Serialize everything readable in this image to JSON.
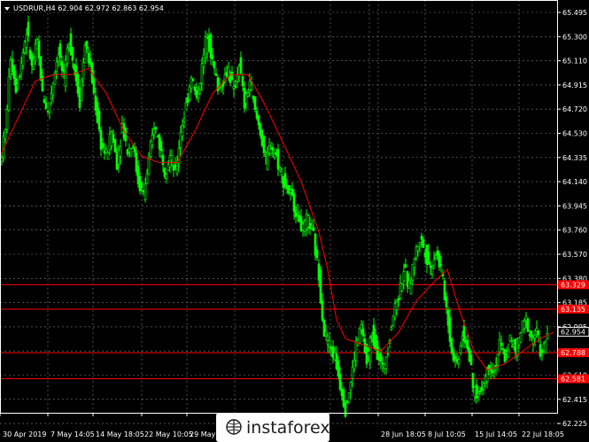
{
  "window": {
    "symbol_info": "USDRUR,H4  62.904 62.972 62.863 62.954",
    "watermark": "instaforex"
  },
  "colors": {
    "background": "#000000",
    "grid": "#808080",
    "bull_candle": "#00ff00",
    "bear_candle": "#00ff00",
    "moving_average": "#ff0000",
    "level_line": "#ff0000",
    "current_price_tag": "#ffffff"
  },
  "chart_data": {
    "type": "candlestick",
    "title": "USDRUR,H4",
    "ohlc_header": {
      "open": 62.904,
      "high": 62.972,
      "low": 62.863,
      "close": 62.954
    },
    "y_ticks": [
      "65.495",
      "65.300",
      "65.110",
      "64.915",
      "64.720",
      "64.530",
      "64.335",
      "64.140",
      "63.945",
      "63.760",
      "63.570",
      "63.380",
      "63.185",
      "62.995",
      "62.800",
      "62.610",
      "62.415",
      "62.225"
    ],
    "x_ticks": [
      "30 Apr 2019",
      "7 May 14:05",
      "14 May 18:05",
      "22 May 10:05",
      "29 May",
      "",
      "",
      "",
      "",
      "28 Jun 18:05",
      "8 Jul 10:05",
      "15 Jul 14:05",
      "22 Jul 18:05"
    ],
    "ylim": [
      62.19,
      65.55
    ],
    "levels": [
      {
        "label": "63.329",
        "value": 63.329
      },
      {
        "label": "63.135",
        "value": 63.135
      },
      {
        "label": "62.788",
        "value": 62.788
      },
      {
        "label": "62.581",
        "value": 62.581
      }
    ],
    "current_price": {
      "label": "62.954",
      "value": 62.954
    },
    "price_path": [
      [
        0,
        64.3
      ],
      [
        6,
        64.55
      ],
      [
        12,
        65.15
      ],
      [
        18,
        64.9
      ],
      [
        24,
        65.1
      ],
      [
        30,
        65.35
      ],
      [
        36,
        65.05
      ],
      [
        42,
        65.25
      ],
      [
        48,
        64.85
      ],
      [
        54,
        64.7
      ],
      [
        60,
        64.95
      ],
      [
        66,
        65.2
      ],
      [
        72,
        64.95
      ],
      [
        78,
        65.3
      ],
      [
        84,
        65.05
      ],
      [
        90,
        64.8
      ],
      [
        96,
        65.25
      ],
      [
        102,
        65.05
      ],
      [
        108,
        64.75
      ],
      [
        114,
        64.45
      ],
      [
        120,
        64.35
      ],
      [
        126,
        64.55
      ],
      [
        132,
        64.3
      ],
      [
        138,
        64.6
      ],
      [
        144,
        64.4
      ],
      [
        150,
        64.45
      ],
      [
        156,
        64.15
      ],
      [
        162,
        64.05
      ],
      [
        168,
        64.3
      ],
      [
        174,
        64.6
      ],
      [
        180,
        64.45
      ],
      [
        186,
        64.25
      ],
      [
        192,
        64.35
      ],
      [
        198,
        64.2
      ],
      [
        204,
        64.55
      ],
      [
        210,
        64.75
      ],
      [
        216,
        65.0
      ],
      [
        222,
        64.8
      ],
      [
        228,
        65.05
      ],
      [
        234,
        65.35
      ],
      [
        240,
        65.1
      ],
      [
        246,
        64.9
      ],
      [
        252,
        64.95
      ],
      [
        258,
        65.05
      ],
      [
        264,
        64.85
      ],
      [
        270,
        65.1
      ],
      [
        276,
        64.75
      ],
      [
        282,
        64.95
      ],
      [
        288,
        64.7
      ],
      [
        294,
        64.55
      ],
      [
        300,
        64.3
      ],
      [
        306,
        64.45
      ],
      [
        312,
        64.35
      ],
      [
        318,
        64.2
      ],
      [
        324,
        64.1
      ],
      [
        330,
        64.0
      ],
      [
        336,
        63.9
      ],
      [
        342,
        63.75
      ],
      [
        348,
        63.85
      ],
      [
        354,
        63.7
      ],
      [
        360,
        63.4
      ],
      [
        366,
        62.95
      ],
      [
        372,
        62.85
      ],
      [
        378,
        62.75
      ],
      [
        384,
        62.55
      ],
      [
        390,
        62.35
      ],
      [
        396,
        62.55
      ],
      [
        402,
        62.85
      ],
      [
        408,
        63.0
      ],
      [
        414,
        62.7
      ],
      [
        420,
        62.95
      ],
      [
        426,
        62.8
      ],
      [
        432,
        62.65
      ],
      [
        438,
        62.85
      ],
      [
        444,
        63.1
      ],
      [
        450,
        63.25
      ],
      [
        456,
        63.45
      ],
      [
        462,
        63.3
      ],
      [
        468,
        63.55
      ],
      [
        474,
        63.7
      ],
      [
        480,
        63.6
      ],
      [
        486,
        63.45
      ],
      [
        492,
        63.6
      ],
      [
        498,
        63.45
      ],
      [
        504,
        63.15
      ],
      [
        510,
        62.8
      ],
      [
        516,
        62.7
      ],
      [
        522,
        62.95
      ],
      [
        528,
        62.85
      ],
      [
        534,
        62.5
      ],
      [
        540,
        62.45
      ],
      [
        546,
        62.55
      ],
      [
        552,
        62.7
      ],
      [
        558,
        62.65
      ],
      [
        564,
        62.85
      ],
      [
        570,
        62.75
      ],
      [
        576,
        62.9
      ],
      [
        582,
        62.8
      ],
      [
        588,
        62.95
      ],
      [
        594,
        63.05
      ],
      [
        600,
        62.9
      ],
      [
        606,
        62.95
      ],
      [
        612,
        62.75
      ],
      [
        618,
        62.95
      ]
    ],
    "ma_path": [
      [
        0,
        64.35
      ],
      [
        20,
        64.65
      ],
      [
        40,
        64.95
      ],
      [
        60,
        65.0
      ],
      [
        80,
        65.0
      ],
      [
        100,
        65.05
      ],
      [
        120,
        64.85
      ],
      [
        140,
        64.55
      ],
      [
        160,
        64.35
      ],
      [
        180,
        64.3
      ],
      [
        200,
        64.3
      ],
      [
        220,
        64.55
      ],
      [
        240,
        64.85
      ],
      [
        260,
        65.0
      ],
      [
        280,
        65.0
      ],
      [
        300,
        64.75
      ],
      [
        320,
        64.45
      ],
      [
        340,
        64.15
      ],
      [
        360,
        63.75
      ],
      [
        370,
        63.45
      ],
      [
        380,
        63.05
      ],
      [
        390,
        62.9
      ],
      [
        410,
        62.85
      ],
      [
        430,
        62.8
      ],
      [
        450,
        62.95
      ],
      [
        470,
        63.2
      ],
      [
        490,
        63.35
      ],
      [
        505,
        63.45
      ],
      [
        520,
        63.1
      ],
      [
        535,
        62.8
      ],
      [
        550,
        62.65
      ],
      [
        570,
        62.7
      ],
      [
        590,
        62.8
      ],
      [
        610,
        62.9
      ],
      [
        625,
        62.95
      ]
    ]
  }
}
